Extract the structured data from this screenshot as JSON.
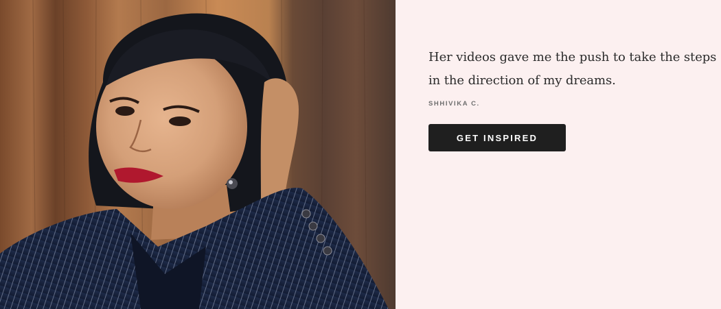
{
  "testimonial": {
    "quote": "Her videos gave me the push to take the steps in the direction of my dreams.",
    "author": "SHHIVIKA C.",
    "cta_label": "GET INSPIRED"
  },
  "colors": {
    "panel_background": "#fcf0f0",
    "button_background": "#1f1f1f",
    "button_text": "#ffffff",
    "quote_text": "#2b2b2b",
    "author_text": "#6e6e6e"
  }
}
